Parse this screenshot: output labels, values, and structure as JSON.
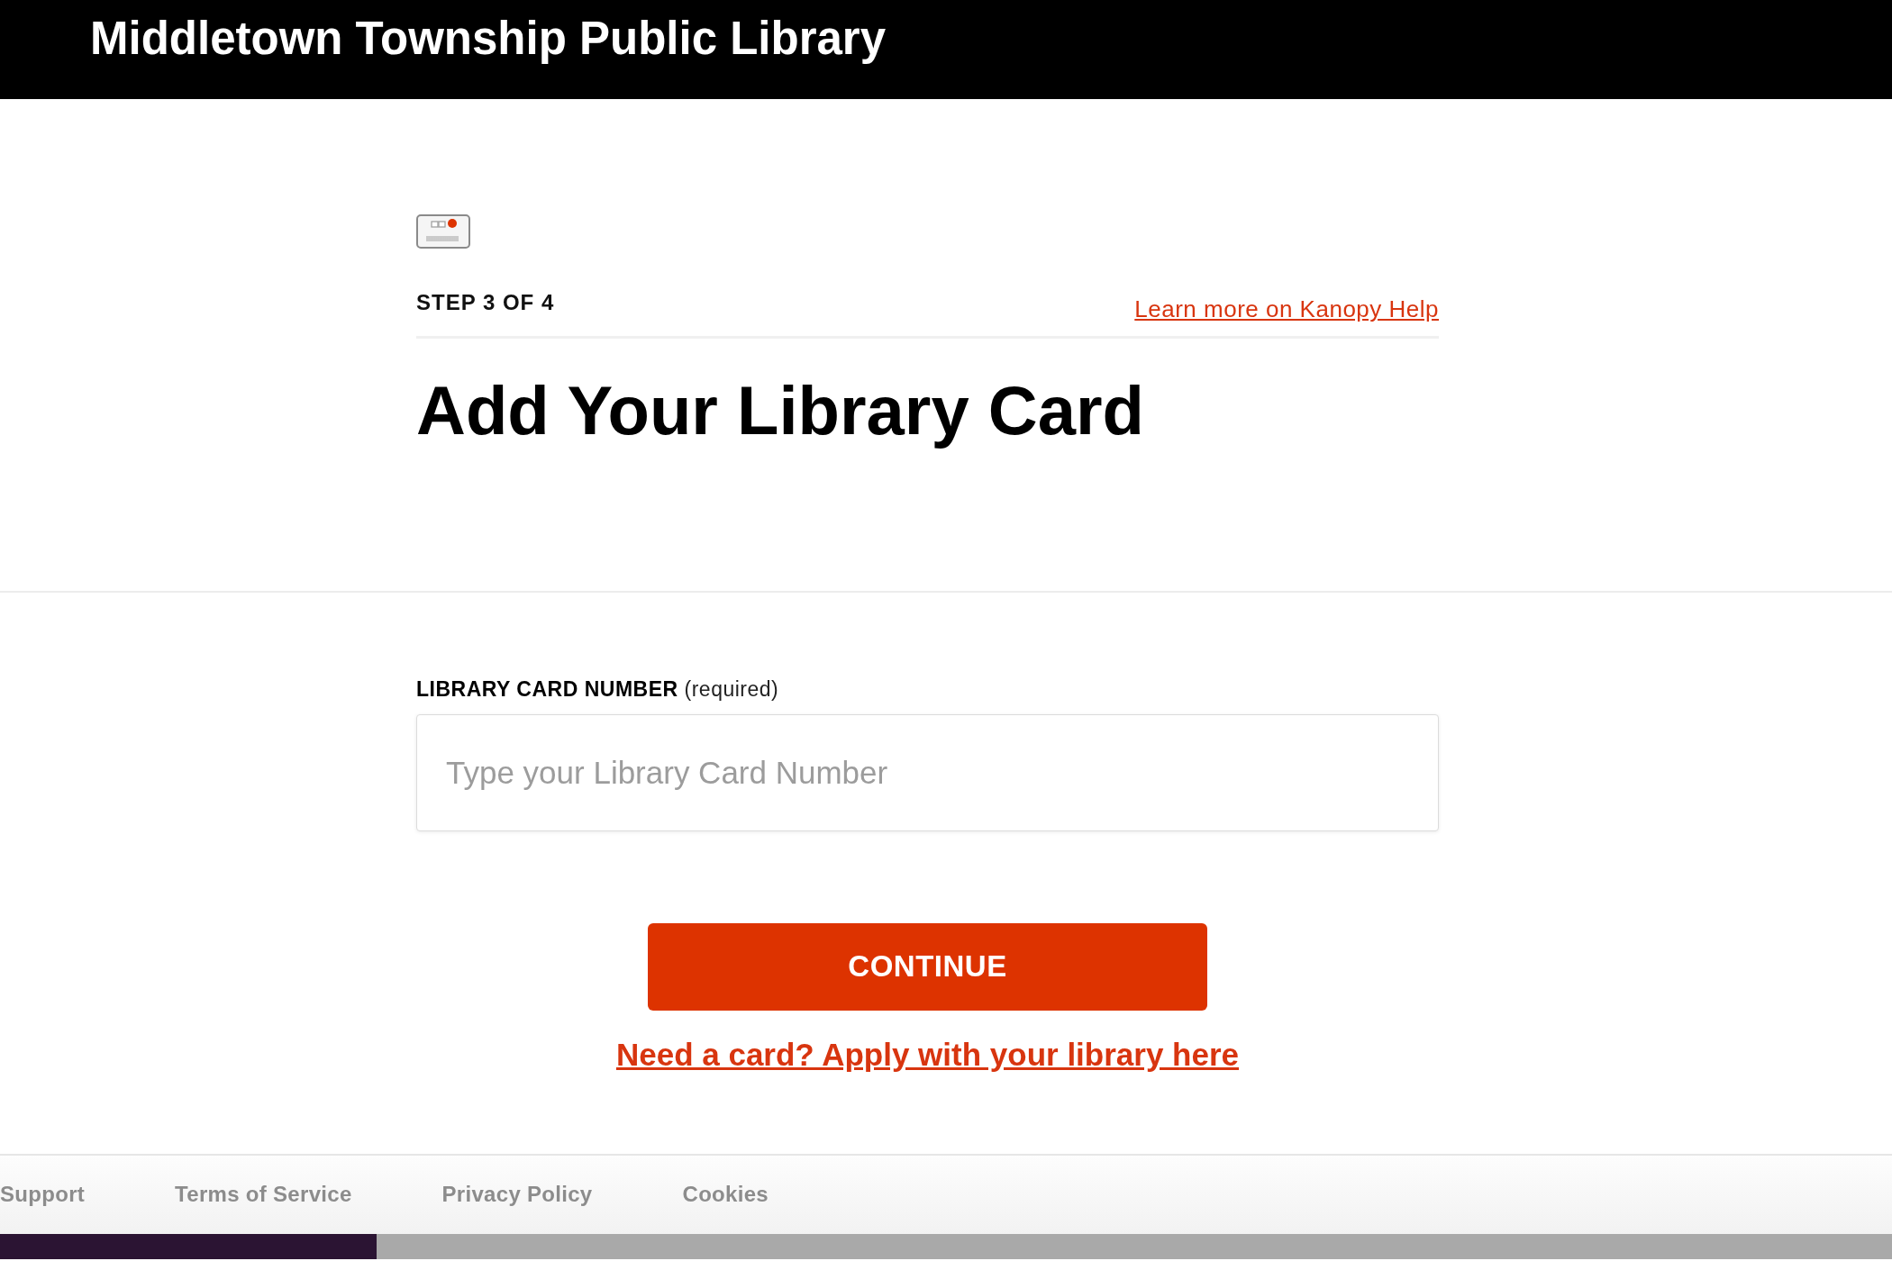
{
  "header": {
    "title": "Middletown Township Public Library"
  },
  "intro": {
    "step": "STEP 3 OF 4",
    "help_link": "Learn more on Kanopy Help",
    "heading": "Add Your Library Card"
  },
  "form": {
    "label": "**LIBRARY CARD NUMBER** (required)",
    "placeholder": "Type your Library Card Number",
    "button": "CONTINUE",
    "apply_link": "Need a card? Apply with your library here"
  },
  "footer": {
    "links": [
      "Support",
      "Terms of Service",
      "Privacy Policy",
      "Cookies"
    ]
  }
}
